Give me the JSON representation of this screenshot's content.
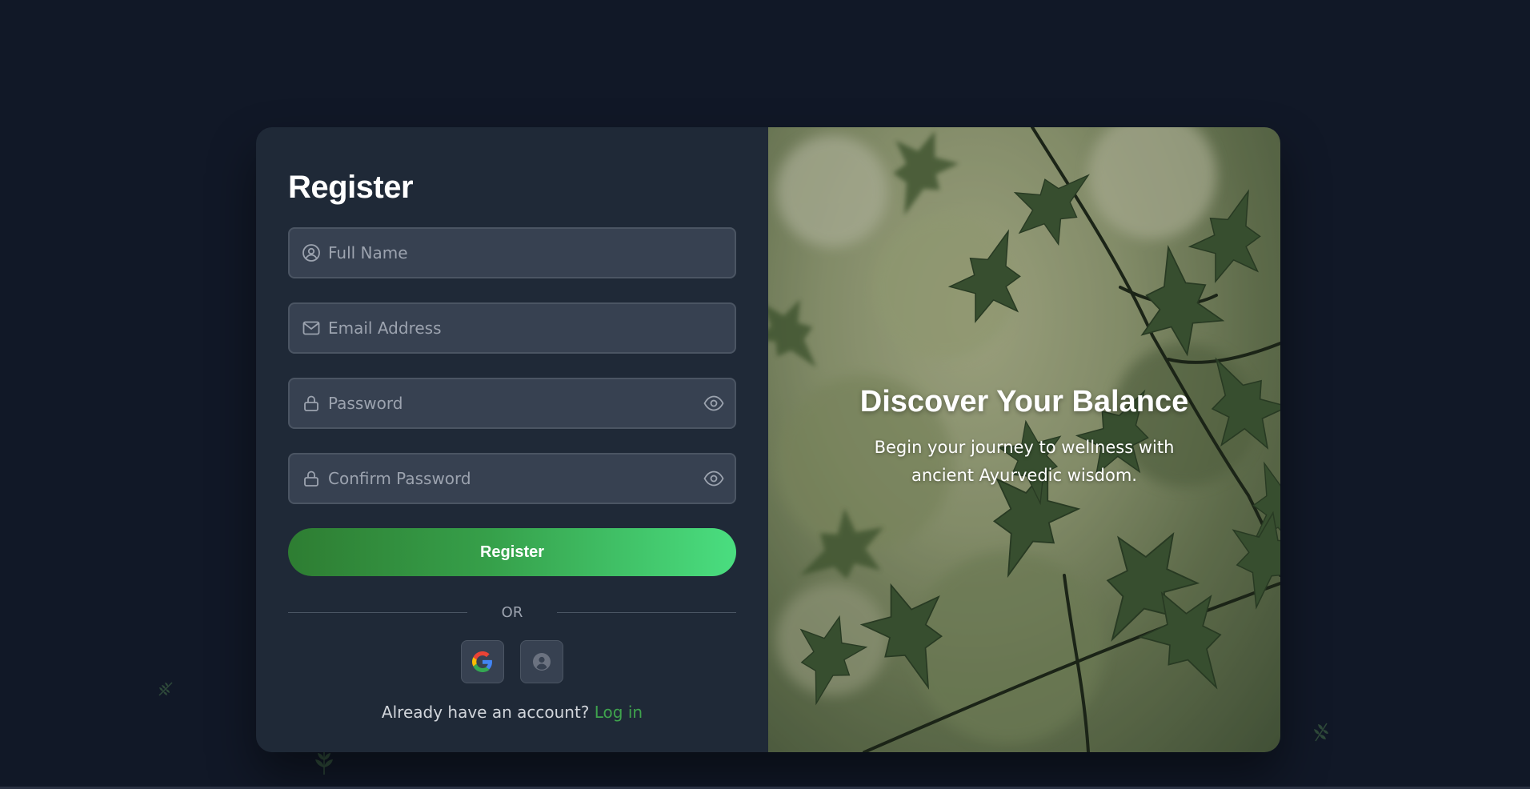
{
  "form": {
    "title": "Register",
    "fields": {
      "full_name": {
        "placeholder": "Full Name",
        "value": "",
        "icon": "user-circle-icon"
      },
      "email": {
        "placeholder": "Email Address",
        "value": "",
        "icon": "mail-icon"
      },
      "password": {
        "placeholder": "Password",
        "value": "",
        "icon": "lock-icon",
        "toggle_icon": "eye-icon"
      },
      "confirm_password": {
        "placeholder": "Confirm Password",
        "value": "",
        "icon": "lock-icon",
        "toggle_icon": "eye-icon"
      }
    },
    "submit_label": "Register",
    "divider_text": "OR",
    "social": [
      {
        "icon": "google-icon"
      },
      {
        "icon": "user-silhouette-icon"
      }
    ],
    "login_prompt": "Already have an account?",
    "login_link": "Log in"
  },
  "hero": {
    "title": "Discover Your Balance",
    "subtitle": "Begin your journey to wellness with ancient Ayurvedic wisdom."
  },
  "colors": {
    "background": "#111827",
    "card_left": "#1f2937",
    "input_bg": "#374151",
    "accent_green": "#3fa34d",
    "button_gradient_start": "#2e7d32",
    "button_gradient_end": "#4ade80"
  }
}
